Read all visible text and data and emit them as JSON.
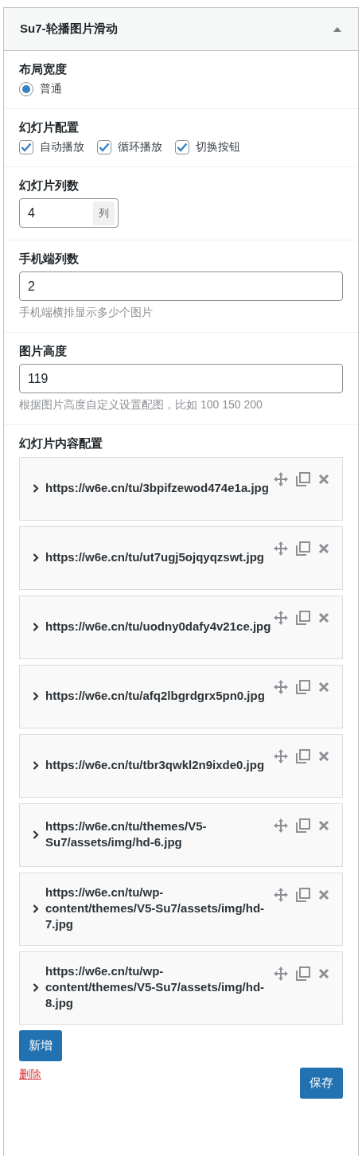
{
  "panel": {
    "title": "Su7-轮播图片滑动",
    "expanded": true
  },
  "layout_width": {
    "label": "布局宽度",
    "options": [
      {
        "label": "普通",
        "selected": true
      }
    ]
  },
  "slide_config": {
    "label": "幻灯片配置",
    "options": [
      {
        "label": "自动播放",
        "checked": true
      },
      {
        "label": "循环播放",
        "checked": true
      },
      {
        "label": "切换按钮",
        "checked": true
      }
    ]
  },
  "columns": {
    "label": "幻灯片列数",
    "value": "4",
    "unit": "列"
  },
  "mobile_columns": {
    "label": "手机端列数",
    "value": "2",
    "help": "手机端横排显示多少个图片"
  },
  "image_height": {
    "label": "图片高度",
    "value": "119",
    "help": "根据图片高度自定义设置配图，比如 100 150 200"
  },
  "slides": {
    "label": "幻灯片内容配置",
    "items": [
      {
        "title": "https://w6e.cn/tu/3bpifzewod474e1a.jpg",
        "expanded": false
      },
      {
        "title": "https://w6e.cn/tu/ut7ugj5ojqyqzswt.jpg",
        "expanded": false
      },
      {
        "title": "https://w6e.cn/tu/uodny0dafy4v21ce.jpg",
        "expanded": false
      },
      {
        "title": "https://w6e.cn/tu/afq2lbgrdgrx5pn0.jpg",
        "expanded": false
      },
      {
        "title": "https://w6e.cn/tu/tbr3qwkl2n9ixde0.jpg",
        "expanded": false
      },
      {
        "title": "https://w6e.cn/tu/themes/V5-Su7/assets/img/hd-6.jpg",
        "expanded": false
      },
      {
        "title": "https://w6e.cn/tu/wp-content/themes/V5-Su7/assets/img/hd-7.jpg",
        "expanded": false
      },
      {
        "title": "https://w6e.cn/tu/wp-content/themes/V5-Su7/assets/img/hd-8.jpg",
        "expanded": false
      }
    ],
    "add_button": "新增"
  },
  "footer": {
    "delete_link": "删除",
    "save_button": "保存"
  }
}
